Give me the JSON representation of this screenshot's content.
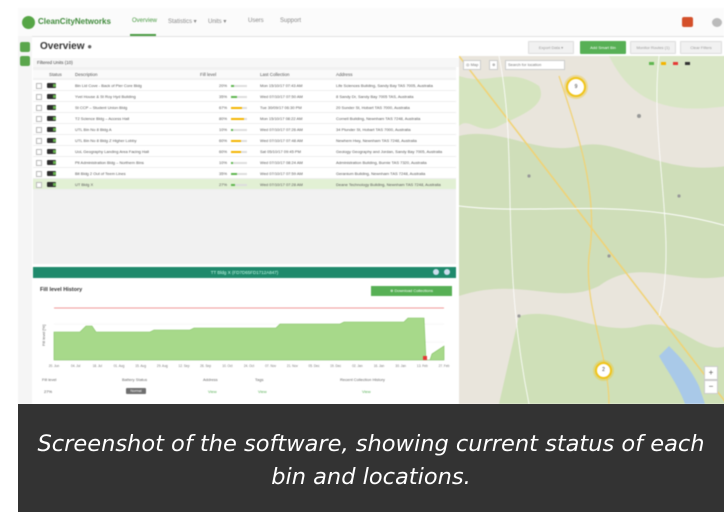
{
  "app": {
    "brand": "CleanCityNetworks",
    "nav_tabs": [
      "Overview",
      "Statistics ▾",
      "Units ▾",
      "Users",
      "Support"
    ],
    "active_tab": 0
  },
  "overview": {
    "title": "Overview",
    "info_icon": "info-circle-icon",
    "toolbar_buttons": [
      "Export Data ▾",
      "Add Smart Bin",
      "Monitor Routes (1)",
      "Clear Filters"
    ]
  },
  "table": {
    "filter_label": "Filtered Units (10)",
    "columns": [
      "Status",
      "Description",
      "Fill level",
      "Last Collection",
      "Address"
    ],
    "rows": [
      {
        "description": "Bin Lid Cove - Back of Pier Core Bldg",
        "fill": "20%",
        "fill_frac": 0.2,
        "fill_color": "#5fb64f",
        "last": "Mon 15/10/17 07:43 AM",
        "address": "Life Sciences Building, Sandy Bay TAS 7005, Australia"
      },
      {
        "description": "Yvel House & St Roy Hyd Building",
        "fill": "35%",
        "fill_frac": 0.35,
        "fill_color": "#5fb64f",
        "last": "Wed 07/10/17 07:50 AM",
        "address": "8 Sandy Dr, Sandy Bay 7005 TAS, Australia"
      },
      {
        "description": "St CCP – Student Union Bldg",
        "fill": "67%",
        "fill_frac": 0.67,
        "fill_color": "#f4b400",
        "last": "Tue 30/09/17 06:30 PM",
        "address": "20 Sunder St, Hobart TAS 7000, Australia"
      },
      {
        "description": "T2 Science Bldg – Access Hall",
        "fill": "80%",
        "fill_frac": 0.8,
        "fill_color": "#f4b400",
        "last": "Mon 15/10/17 08:22 AM",
        "address": "Cornell Building, Newnham TAS 7248, Australia"
      },
      {
        "description": "UTL Bin No 8 Bldg A",
        "fill": "10%",
        "fill_frac": 0.1,
        "fill_color": "#5fb64f",
        "last": "Wed 07/10/17 07:26 AM",
        "address": "34 Plunder St, Hobart TAS 7000, Australia"
      },
      {
        "description": "UTL Bin No 8 Bldg Z Higher Lobby",
        "fill": "60%",
        "fill_frac": 0.6,
        "fill_color": "#f4b400",
        "last": "Wed 07/10/17 07:48 AM",
        "address": "Newhem Hwy, Newnham TAS 7248, Australia"
      },
      {
        "description": "UoL Geography Landing Area Facing Hall",
        "fill": "60%",
        "fill_frac": 0.6,
        "fill_color": "#f4b400",
        "last": "Sat 05/10/17 09:45 PM",
        "address": "Geology Geography and Jordan, Sandy Bay 7005, Australia"
      },
      {
        "description": "Pit Administration Bldg – Northern Bins",
        "fill": "10%",
        "fill_frac": 0.1,
        "fill_color": "#5fb64f",
        "last": "Wed 07/10/17 08:24 AM",
        "address": "Administration Building, Burnie TAS 7320, Australia"
      },
      {
        "description": "Bit Bldg 2 Out of Teem Lines",
        "fill": "35%",
        "fill_frac": 0.35,
        "fill_color": "#5fb64f",
        "last": "Wed 07/10/17 07:59 AM",
        "address": "Geranium Building, Newnham TAS 7248, Australia"
      },
      {
        "description": "UT Bldg X",
        "fill": "27%",
        "fill_frac": 0.27,
        "fill_color": "#5fb64f",
        "last": "Wed 07/10/17 07:28 AM",
        "address": "Deane Technology Building, Newnham TAS 7248, Australia"
      }
    ],
    "selected_row": 9
  },
  "detail": {
    "bar_title": "TT Bldg X (FD7D65FD1712A847)",
    "history_title": "Fill level History",
    "history_button": "⊕ Download Collections",
    "ylabel": "Fill level [%]",
    "x_ticks": [
      "20. Jun",
      "04. Jul",
      "18. Jul",
      "01. Aug",
      "15. Aug",
      "29. Aug",
      "12. Sep",
      "26. Sep",
      "10. Oct",
      "24. Oct",
      "07. Nov",
      "21. Nov",
      "05. Dec",
      "19. Dec",
      "02. Jan",
      "16. Jan",
      "30. Jan",
      "13. Feb",
      "27. Feb"
    ],
    "footer_headers": [
      "Fill level",
      "Battery Status",
      "Address",
      "Tags",
      "Recent Collection History"
    ],
    "footer_values": [
      "27%",
      "Normal",
      "View",
      "View",
      "View"
    ]
  },
  "map": {
    "controls": [
      "◎ Map",
      "⊕",
      "Search for location"
    ],
    "legend_colors": [
      "#5fb64f",
      "#f4b400",
      "#e53935",
      "#333333"
    ],
    "clusters": [
      "9",
      "2"
    ],
    "zoom": [
      "+",
      "−"
    ]
  },
  "caption": {
    "text": "Screenshot of the software, showing current status of each bin and locations."
  }
}
